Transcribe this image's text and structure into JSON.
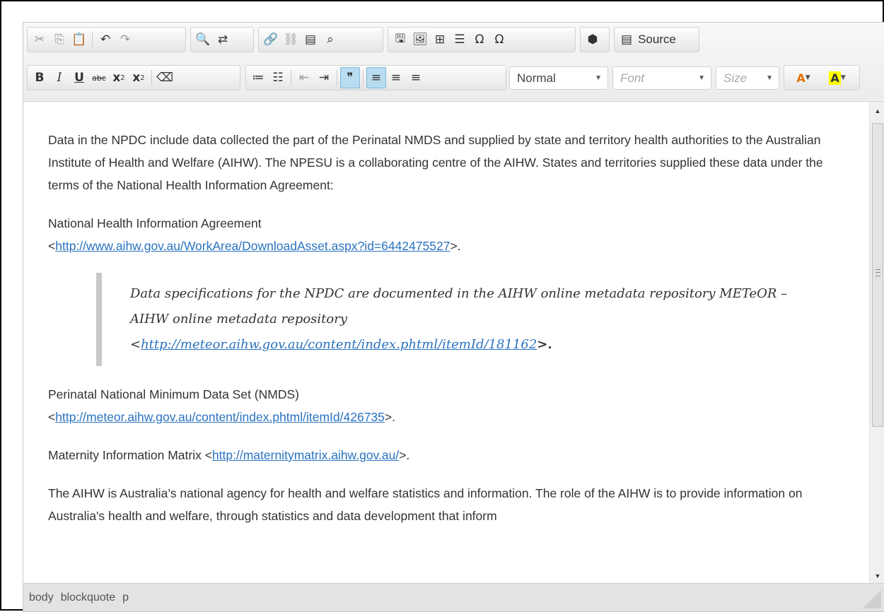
{
  "toolbar": {
    "row1": {
      "source_label": "Source"
    },
    "row2": {
      "format_combo": "Normal",
      "font_combo": "Font",
      "size_combo": "Size",
      "bold": "B",
      "italic": "I",
      "underline": "U",
      "strike": "abc",
      "subscript": "x",
      "superscript": "x",
      "blockquote": "❞"
    }
  },
  "document": {
    "para1": "Data in the NPDC include data collected the part of the Perinatal NMDS and supplied by state and territory health authorities to the Australian Institute of Health and Welfare (AIHW). The NPESU is a collaborating centre of the AIHW. States and territories supplied these data under the terms of the National Health Information Agreement:",
    "para2_text": "National Health Information Agreement",
    "para2_open": "<",
    "para2_link": "http://www.aihw.gov.au/WorkArea/DownloadAsset.aspx?id=6442475527",
    "para2_close": ">.",
    "quote_text": "Data specifications for the NPDC are documented in the AIHW online metadata repository METeOR – AIHW online metadata repository",
    "quote_open": "<",
    "quote_link": "http://meteor.aihw.gov.au/content/index.phtml/itemId/181162",
    "quote_close": ">.",
    "para3_text": "Perinatal National Minimum Data Set (NMDS)",
    "para3_open": "<",
    "para3_link": "http://meteor.aihw.gov.au/content/index.phtml/itemId/426735",
    "para3_close": ">.",
    "para4_text": "Maternity Information Matrix <",
    "para4_link": "http://maternitymatrix.aihw.gov.au/",
    "para4_close": ">.",
    "para5": "The AIHW is Australia’s national agency for health and welfare statistics and information. The role of the AIHW is to provide information on Australia's health and welfare, through statistics and data development that inform"
  },
  "statusbar": {
    "path": [
      "body",
      "blockquote",
      "p"
    ]
  },
  "colors": {
    "link": "#2a73c0",
    "active_button": "#b9dcf0",
    "quote_border": "#c8c8c8"
  }
}
